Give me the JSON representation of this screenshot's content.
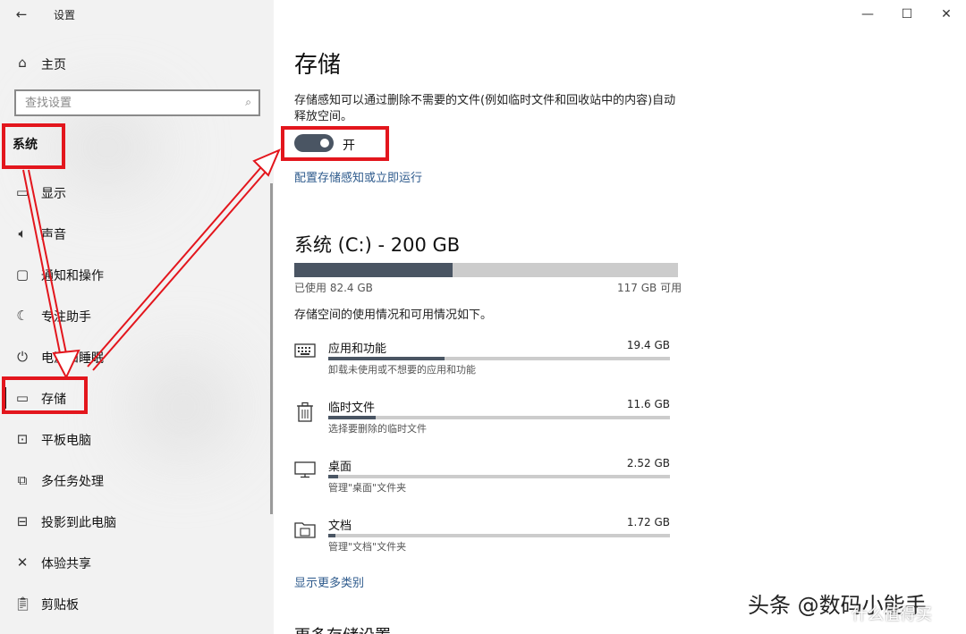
{
  "window": {
    "app_title": "设置",
    "back_icon": "back-arrow-icon",
    "controls": {
      "minimize": "—",
      "maximize": "☐",
      "close": "✕"
    }
  },
  "sidebar": {
    "home_label": "主页",
    "search_placeholder": "查找设置",
    "section_title": "系统",
    "items": [
      {
        "label": "显示",
        "icon": "monitor-icon",
        "glyph": "▭"
      },
      {
        "label": "声音",
        "icon": "speaker-icon",
        "glyph": "🔈︎"
      },
      {
        "label": "通知和操作",
        "icon": "notification-icon",
        "glyph": "▢"
      },
      {
        "label": "专注助手",
        "icon": "moon-icon",
        "glyph": "☾"
      },
      {
        "label": "电源和睡眠",
        "icon": "power-icon",
        "glyph": "⏻"
      },
      {
        "label": "存储",
        "icon": "storage-icon",
        "glyph": "▭",
        "active": true
      },
      {
        "label": "平板电脑",
        "icon": "tablet-icon",
        "glyph": "⊡"
      },
      {
        "label": "多任务处理",
        "icon": "multitask-icon",
        "glyph": "⧉"
      },
      {
        "label": "投影到此电脑",
        "icon": "projector-icon",
        "glyph": "⊟"
      },
      {
        "label": "体验共享",
        "icon": "share-icon",
        "glyph": "✕"
      },
      {
        "label": "剪贴板",
        "icon": "clipboard-icon",
        "glyph": "📋︎"
      }
    ]
  },
  "main": {
    "title": "存储",
    "description": "存储感知可以通过删除不需要的文件(例如临时文件和回收站中的内容)自动释放空间。",
    "toggle_state_label": "开",
    "toggle_on": true,
    "configure_link": "配置存储感知或立即运行",
    "drive": {
      "title": "系统 (C:) - 200 GB",
      "used_label": "已使用 82.4 GB",
      "free_label": "117 GB 可用",
      "used_fraction": 0.412
    },
    "usage_note": "存储空间的使用情况和可用情况如下。",
    "categories": [
      {
        "name": "应用和功能",
        "size": "19.4 GB",
        "desc": "卸载未使用或不想要的应用和功能",
        "icon": "keyboard-icon",
        "fraction": 0.34
      },
      {
        "name": "临时文件",
        "size": "11.6 GB",
        "desc": "选择要删除的临时文件",
        "icon": "trash-icon",
        "fraction": 0.14
      },
      {
        "name": "桌面",
        "size": "2.52 GB",
        "desc": "管理\"桌面\"文件夹",
        "icon": "desktop-icon",
        "fraction": 0.03
      },
      {
        "name": "文档",
        "size": "1.72 GB",
        "desc": "管理\"文档\"文件夹",
        "icon": "folder-icon",
        "fraction": 0.02
      }
    ],
    "more_categories_link": "显示更多类别",
    "more_settings_title": "更多存储设置"
  },
  "watermark": {
    "text": "头条 @数码小能手",
    "secondary": "什么值得买"
  },
  "colors": {
    "annotation_red": "#e3161d",
    "bar_fill": "#4a5563",
    "bar_track": "#cccccc",
    "link_blue": "#2d5a8c"
  }
}
